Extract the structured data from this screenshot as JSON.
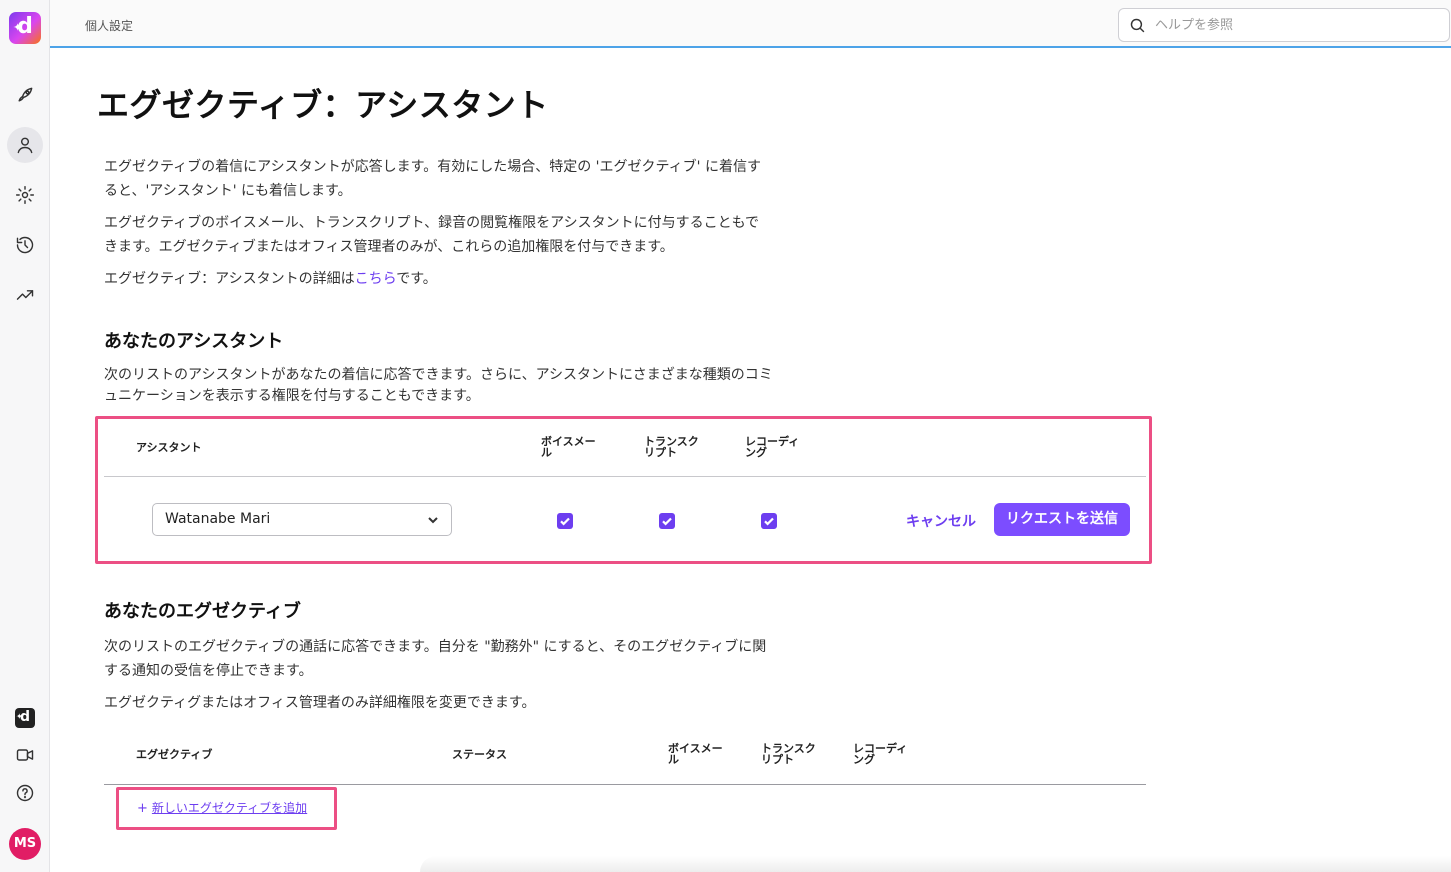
{
  "topbar": {
    "breadcrumb": "個人設定",
    "search_placeholder": "ヘルプを参照"
  },
  "rail": {
    "logo": "d",
    "items": [
      "rocket-icon",
      "user-icon",
      "gear-icon",
      "history-icon",
      "trending-icon"
    ],
    "bottom": [
      "dialpad-icon",
      "video-icon",
      "help-icon"
    ],
    "avatar": "MS"
  },
  "page": {
    "title": "エグゼクティブ：アシスタント",
    "intro_1": "エグゼクティブの着信にアシスタントが応答します。有効にした場合、特定の 'エグゼクティブ' に着信すると、'アシスタント' にも着信します。",
    "intro_2": "エグゼクティブのボイスメール、トランスクリプト、録音の閲覧権限をアシスタントに付与することもできます。エグゼクティブまたはオフィス管理者のみが、これらの追加権限を付与できます。",
    "intro_3_prefix": "エグゼクティブ：アシスタントの詳細は",
    "intro_3_link": "こちら",
    "intro_3_suffix": "です。"
  },
  "assistants": {
    "heading": "あなたのアシスタント",
    "description": "次のリストのアシスタントがあなたの着信に応答できます。さらに、アシスタントにさまざまな種類のコミュニケーションを表示する権限を付与することもできます。",
    "columns": {
      "assistant": "アシスタント",
      "voicemail": "ボイスメール",
      "transcript": "トランスクリプト",
      "recording": "レコーディング"
    },
    "row": {
      "selected": "Watanabe Mari",
      "voicemail": true,
      "transcript": true,
      "recording": true
    },
    "cancel_label": "キャンセル",
    "send_label": "リクエストを送信"
  },
  "executives": {
    "heading": "あなたのエグゼクティブ",
    "description_1": "次のリストのエグゼクティブの通話に応答できます。自分を \"勤務外\" にすると、そのエグゼクティブに関する通知の受信を停止できます。",
    "description_2": "エグゼクティグまたはオフィス管理者のみ詳細権限を変更できます。",
    "columns": {
      "executive": "エグゼクティブ",
      "status": "ステータス",
      "voicemail": "ボイスメール",
      "transcript": "トランスクリプト",
      "recording": "レコーディング"
    },
    "add_plus": "+",
    "add_label": "新しいエグゼクティブを追加"
  },
  "colors": {
    "accent": "#7c4dff",
    "highlight": "#ec4f84",
    "topbar_line": "#4da3e8"
  }
}
